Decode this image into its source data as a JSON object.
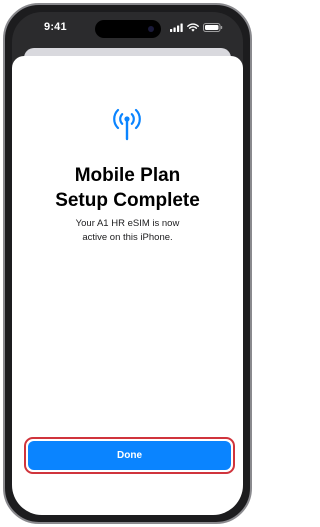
{
  "status_bar": {
    "time": "9:41",
    "icons": [
      "cellular-signal-icon",
      "wifi-icon",
      "battery-icon"
    ]
  },
  "screen": {
    "icon": "antenna-icon",
    "title_lines": [
      "Mobile Plan",
      "Setup Complete"
    ],
    "subtitle_lines": [
      "Your A1 HR eSIM is now",
      "active on this iPhone."
    ]
  },
  "actions": {
    "done_label": "Done"
  },
  "colors": {
    "accent": "#0a84ff",
    "highlight": "#d0343c"
  }
}
